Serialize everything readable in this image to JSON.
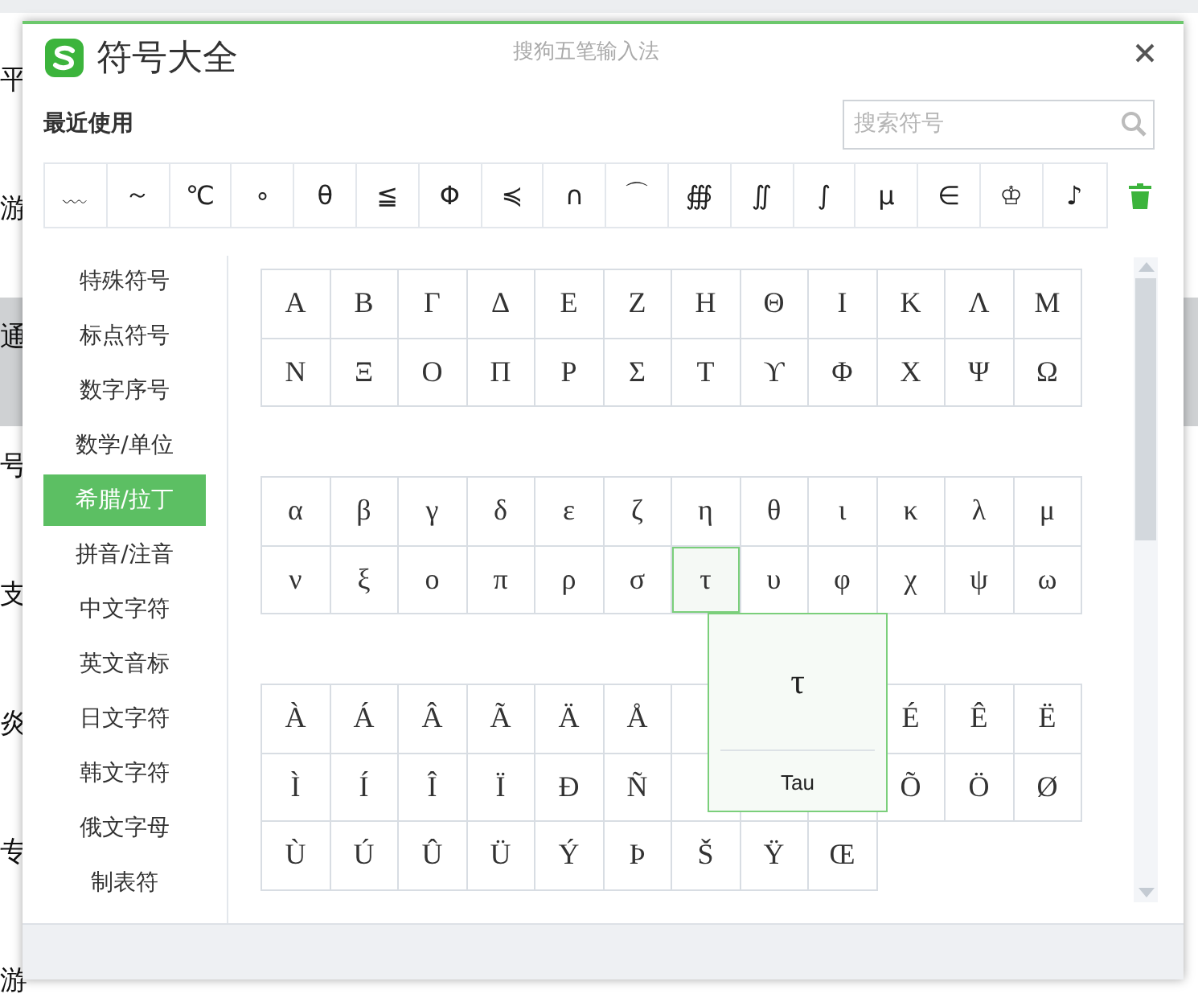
{
  "background": {
    "list_items": [
      {
        "text": "平",
        "selected": false
      },
      {
        "text": "游",
        "selected": false
      },
      {
        "text": "通",
        "selected": true
      },
      {
        "text": "号",
        "selected": false
      },
      {
        "text": "支",
        "selected": false
      },
      {
        "text": "炎",
        "selected": false
      },
      {
        "text": "专",
        "selected": false
      },
      {
        "text": "游",
        "selected": false
      }
    ]
  },
  "dialog": {
    "title": "符号大全",
    "app_name": "搜狗五笔输入法",
    "recent": {
      "label": "最近使用",
      "symbols": [
        "﹏",
        "～",
        "℃",
        "∘",
        "θ",
        "≦",
        "Φ",
        "≼",
        "∩",
        "⌒",
        "∰",
        "∬",
        "∫",
        "μ",
        "∈",
        "♔",
        "♪"
      ]
    },
    "search": {
      "placeholder": "搜索符号"
    },
    "categories": [
      {
        "label": "特殊符号",
        "selected": false
      },
      {
        "label": "标点符号",
        "selected": false
      },
      {
        "label": "数字序号",
        "selected": false
      },
      {
        "label": "数学/单位",
        "selected": false
      },
      {
        "label": "希腊/拉丁",
        "selected": true
      },
      {
        "label": "拼音/注音",
        "selected": false
      },
      {
        "label": "中文字符",
        "selected": false
      },
      {
        "label": "英文音标",
        "selected": false
      },
      {
        "label": "日文字符",
        "selected": false
      },
      {
        "label": "韩文字符",
        "selected": false
      },
      {
        "label": "俄文字母",
        "selected": false
      },
      {
        "label": "制表符",
        "selected": false
      }
    ],
    "groups": [
      {
        "cells": [
          {
            "symbol": "Α",
            "selected": false
          },
          {
            "symbol": "Β",
            "selected": false
          },
          {
            "symbol": "Γ",
            "selected": false
          },
          {
            "symbol": "Δ",
            "selected": false
          },
          {
            "symbol": "Ε",
            "selected": false
          },
          {
            "symbol": "Ζ",
            "selected": false
          },
          {
            "symbol": "Η",
            "selected": false
          },
          {
            "symbol": "Θ",
            "selected": false
          },
          {
            "symbol": "Ι",
            "selected": false
          },
          {
            "symbol": "Κ",
            "selected": false
          },
          {
            "symbol": "Λ",
            "selected": false
          },
          {
            "symbol": "Μ",
            "selected": false
          },
          {
            "symbol": "Ν",
            "selected": false
          },
          {
            "symbol": "Ξ",
            "selected": false
          },
          {
            "symbol": "Ο",
            "selected": false
          },
          {
            "symbol": "Π",
            "selected": false
          },
          {
            "symbol": "Ρ",
            "selected": false
          },
          {
            "symbol": "Σ",
            "selected": false
          },
          {
            "symbol": "Τ",
            "selected": false
          },
          {
            "symbol": "ϒ",
            "selected": false
          },
          {
            "symbol": "Φ",
            "selected": false
          },
          {
            "symbol": "Χ",
            "selected": false
          },
          {
            "symbol": "Ψ",
            "selected": false
          },
          {
            "symbol": "Ω",
            "selected": false
          }
        ]
      },
      {
        "cells": [
          {
            "symbol": "α",
            "selected": false
          },
          {
            "symbol": "β",
            "selected": false
          },
          {
            "symbol": "γ",
            "selected": false
          },
          {
            "symbol": "δ",
            "selected": false
          },
          {
            "symbol": "ε",
            "selected": false
          },
          {
            "symbol": "ζ",
            "selected": false
          },
          {
            "symbol": "η",
            "selected": false
          },
          {
            "symbol": "θ",
            "selected": false
          },
          {
            "symbol": "ι",
            "selected": false
          },
          {
            "symbol": "κ",
            "selected": false
          },
          {
            "symbol": "λ",
            "selected": false
          },
          {
            "symbol": "μ",
            "selected": false
          },
          {
            "symbol": "ν",
            "selected": false
          },
          {
            "symbol": "ξ",
            "selected": false
          },
          {
            "symbol": "ο",
            "selected": false
          },
          {
            "symbol": "π",
            "selected": false
          },
          {
            "symbol": "ρ",
            "selected": false
          },
          {
            "symbol": "σ",
            "selected": false
          },
          {
            "symbol": "τ",
            "selected": true,
            "tooltip": {
              "symbol": "τ",
              "name": "Tau"
            }
          },
          {
            "symbol": "υ",
            "selected": false
          },
          {
            "symbol": "φ",
            "selected": false
          },
          {
            "symbol": "χ",
            "selected": false
          },
          {
            "symbol": "ψ",
            "selected": false
          },
          {
            "symbol": "ω",
            "selected": false
          }
        ]
      },
      {
        "cells": [
          {
            "symbol": "À",
            "selected": false
          },
          {
            "symbol": "Á",
            "selected": false
          },
          {
            "symbol": "Â",
            "selected": false
          },
          {
            "symbol": "Ã",
            "selected": false
          },
          {
            "symbol": "Ä",
            "selected": false
          },
          {
            "symbol": "Å",
            "selected": false
          },
          {},
          {},
          {},
          {
            "symbol": "É",
            "selected": false
          },
          {
            "symbol": "Ê",
            "selected": false
          },
          {
            "symbol": "Ë",
            "selected": false
          },
          {
            "symbol": "Ì",
            "selected": false
          },
          {
            "symbol": "Í",
            "selected": false
          },
          {
            "symbol": "Î",
            "selected": false
          },
          {
            "symbol": "Ï",
            "selected": false
          },
          {
            "symbol": "Ð",
            "selected": false
          },
          {
            "symbol": "Ñ",
            "selected": false
          },
          {},
          {},
          {},
          {
            "symbol": "Õ",
            "selected": false
          },
          {
            "symbol": "Ö",
            "selected": false
          },
          {
            "symbol": "Ø",
            "selected": false
          },
          {
            "symbol": "Ù",
            "selected": false
          },
          {
            "symbol": "Ú",
            "selected": false
          },
          {
            "symbol": "Û",
            "selected": false
          },
          {
            "symbol": "Ü",
            "selected": false
          },
          {
            "symbol": "Ý",
            "selected": false
          },
          {
            "symbol": "Þ",
            "selected": false
          },
          {
            "symbol": "Š",
            "selected": false
          },
          {
            "symbol": "Ÿ",
            "selected": false
          },
          {
            "symbol": "Œ",
            "selected": false
          }
        ]
      }
    ]
  }
}
